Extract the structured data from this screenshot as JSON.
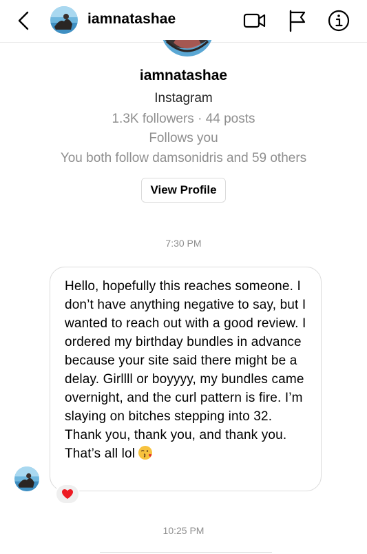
{
  "header": {
    "username": "iamnatashae"
  },
  "profile": {
    "username": "iamnatashae",
    "platform": "Instagram",
    "stats": "1.3K followers · 44 posts",
    "follows_status": "Follows you",
    "mutual": "You both follow damsonidris and 59 others",
    "view_profile_label": "View Profile"
  },
  "thread": {
    "timestamp_1": "7:30 PM",
    "message_text": "Hello, hopefully this reaches someone. I don’t have anything negative to say, but I wanted to reach out with a good review. I ordered my birthday bundles in advance because your site said there might be a delay. Girllll or boyyyy, my bundles came overnight, and the curl pattern is fire. I’m slaying on bitches stepping into 32. Thank you, thank you, and thank you. That’s all lol",
    "message_emoji": "kissing-face-with-heart-emoji",
    "reaction": "red-heart-emoji",
    "timestamp_2": "10:25 PM"
  },
  "icons": {
    "back": "chevron-left-icon",
    "video": "video-camera-icon",
    "flag": "flag-icon",
    "info": "info-icon"
  },
  "colors": {
    "secondary_text": "#8e8e8e",
    "border": "#dbdbdb",
    "heart": "#ed1c24"
  }
}
